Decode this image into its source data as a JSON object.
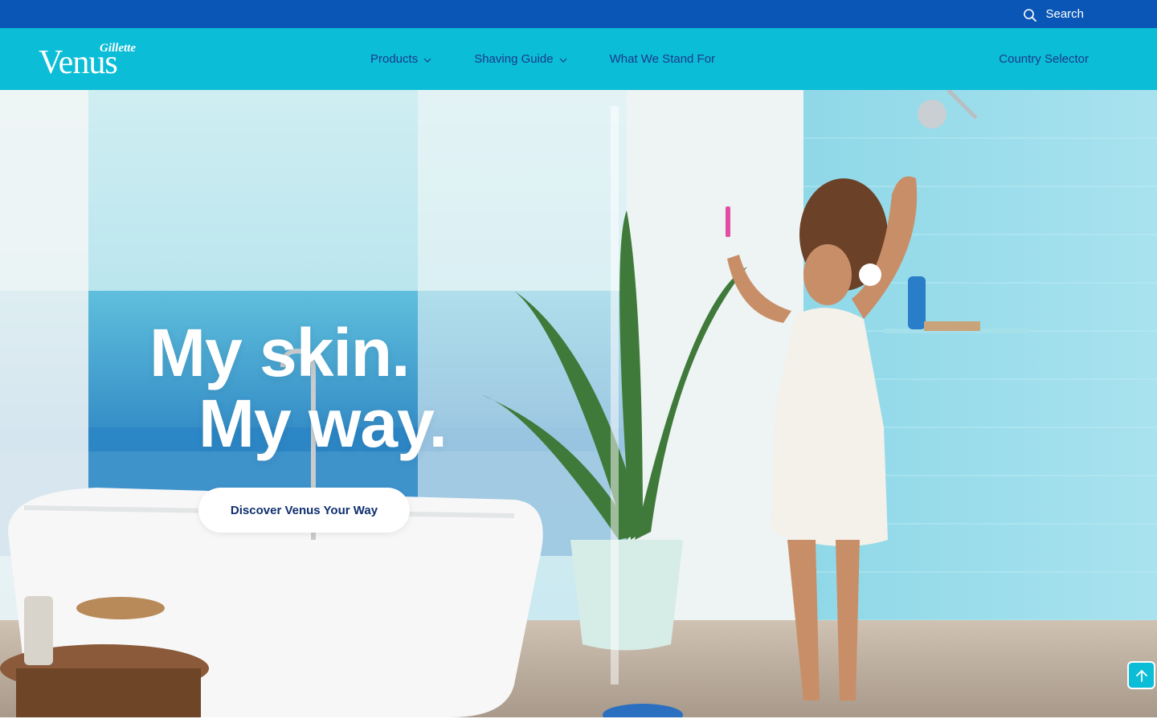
{
  "utility_bar": {
    "search_label": "Search",
    "search_icon": "search-icon"
  },
  "brand": {
    "logo_small": "Gillette",
    "logo_main": "Venus"
  },
  "nav": {
    "items": [
      {
        "label": "Products",
        "has_dropdown": true
      },
      {
        "label": "Shaving Guide",
        "has_dropdown": true
      },
      {
        "label": "What We Stand For",
        "has_dropdown": false
      }
    ],
    "country_selector": "Country Selector"
  },
  "hero": {
    "headline_line1": "My skin.",
    "headline_line2": "My way.",
    "cta_label": "Discover Venus Your Way"
  },
  "scroll_top": {
    "icon": "arrow-up-icon"
  },
  "colors": {
    "utility_bar": "#0a56b6",
    "nav_bar": "#0bbdd6",
    "nav_text": "#1b3a8a",
    "cta_text": "#10306f"
  }
}
